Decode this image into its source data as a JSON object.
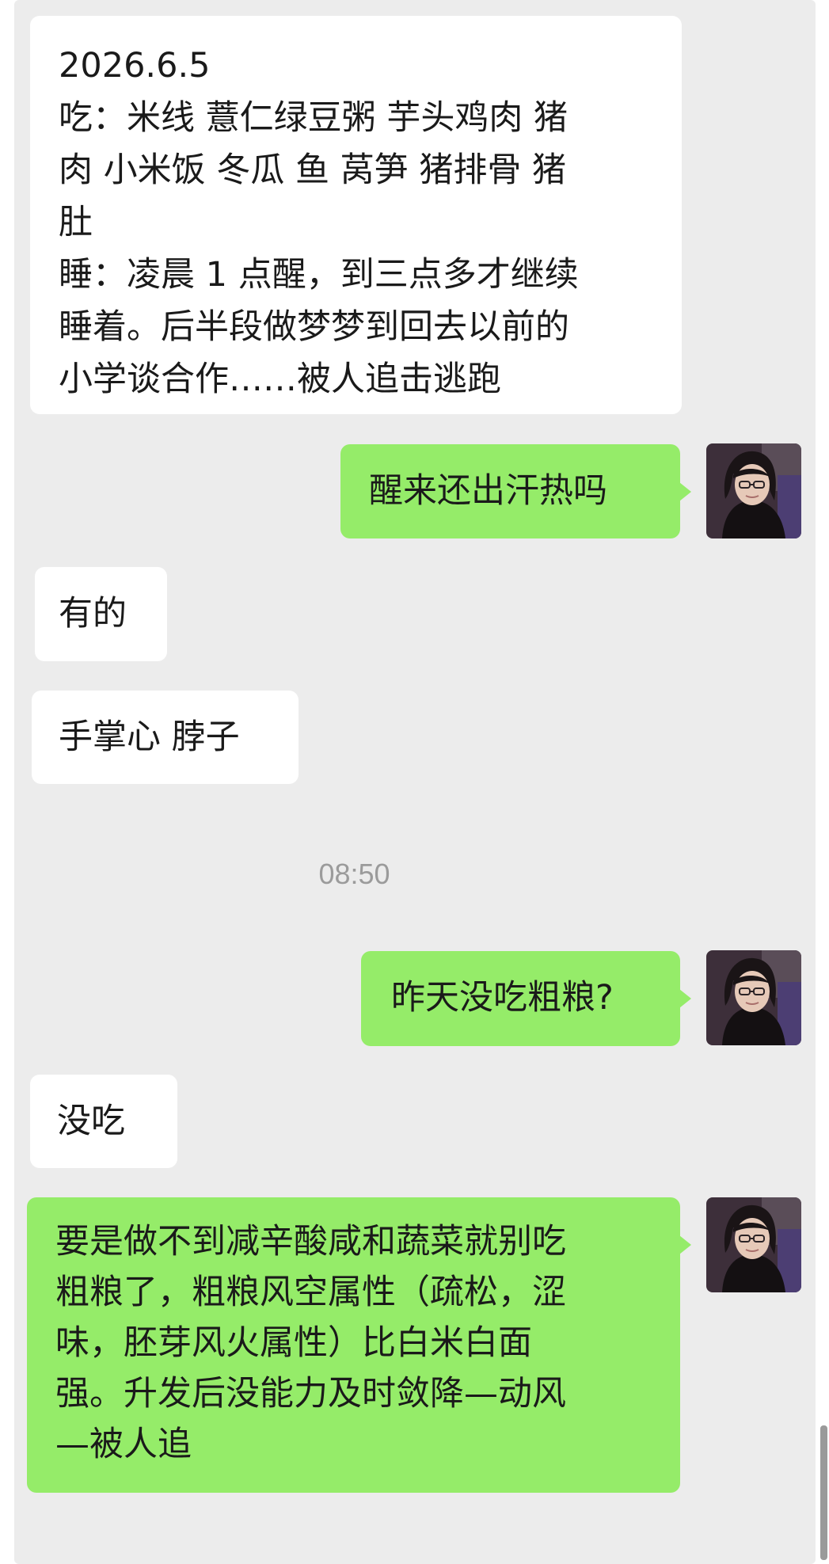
{
  "messages": [
    {
      "side": "received",
      "text": "2026.6.5\n吃：米线 薏仁绿豆粥 芋头鸡肉 猪\n肉 小米饭 冬瓜 鱼 莴笋 猪排骨 猪\n肚\n睡：凌晨 1 点醒，到三点多才继续\n睡着。后半段做梦梦到回去以前的\n小学谈合作……被人追击逃跑"
    },
    {
      "side": "sent",
      "text": "醒来还出汗热吗"
    },
    {
      "side": "received",
      "text": "有的"
    },
    {
      "side": "received",
      "text": "手掌心 脖子"
    },
    {
      "side": "sent",
      "text": "昨天没吃粗粮?"
    },
    {
      "side": "received",
      "text": "没吃"
    },
    {
      "side": "sent",
      "text": "要是做不到减辛酸咸和蔬菜就别吃\n粗粮了，粗粮风空属性（疏松，涩\n味，胚芽风火属性）比白米白面\n强。升发后没能力及时敛降—动风\n—被人追"
    }
  ],
  "timestamp": "08:50",
  "colors": {
    "chat_background": "#ececec",
    "received_bubble": "#ffffff",
    "sent_bubble": "#95ec69",
    "timestamp_text": "#9b9b9b"
  },
  "icons": {
    "avatar": "user-avatar-photo"
  }
}
